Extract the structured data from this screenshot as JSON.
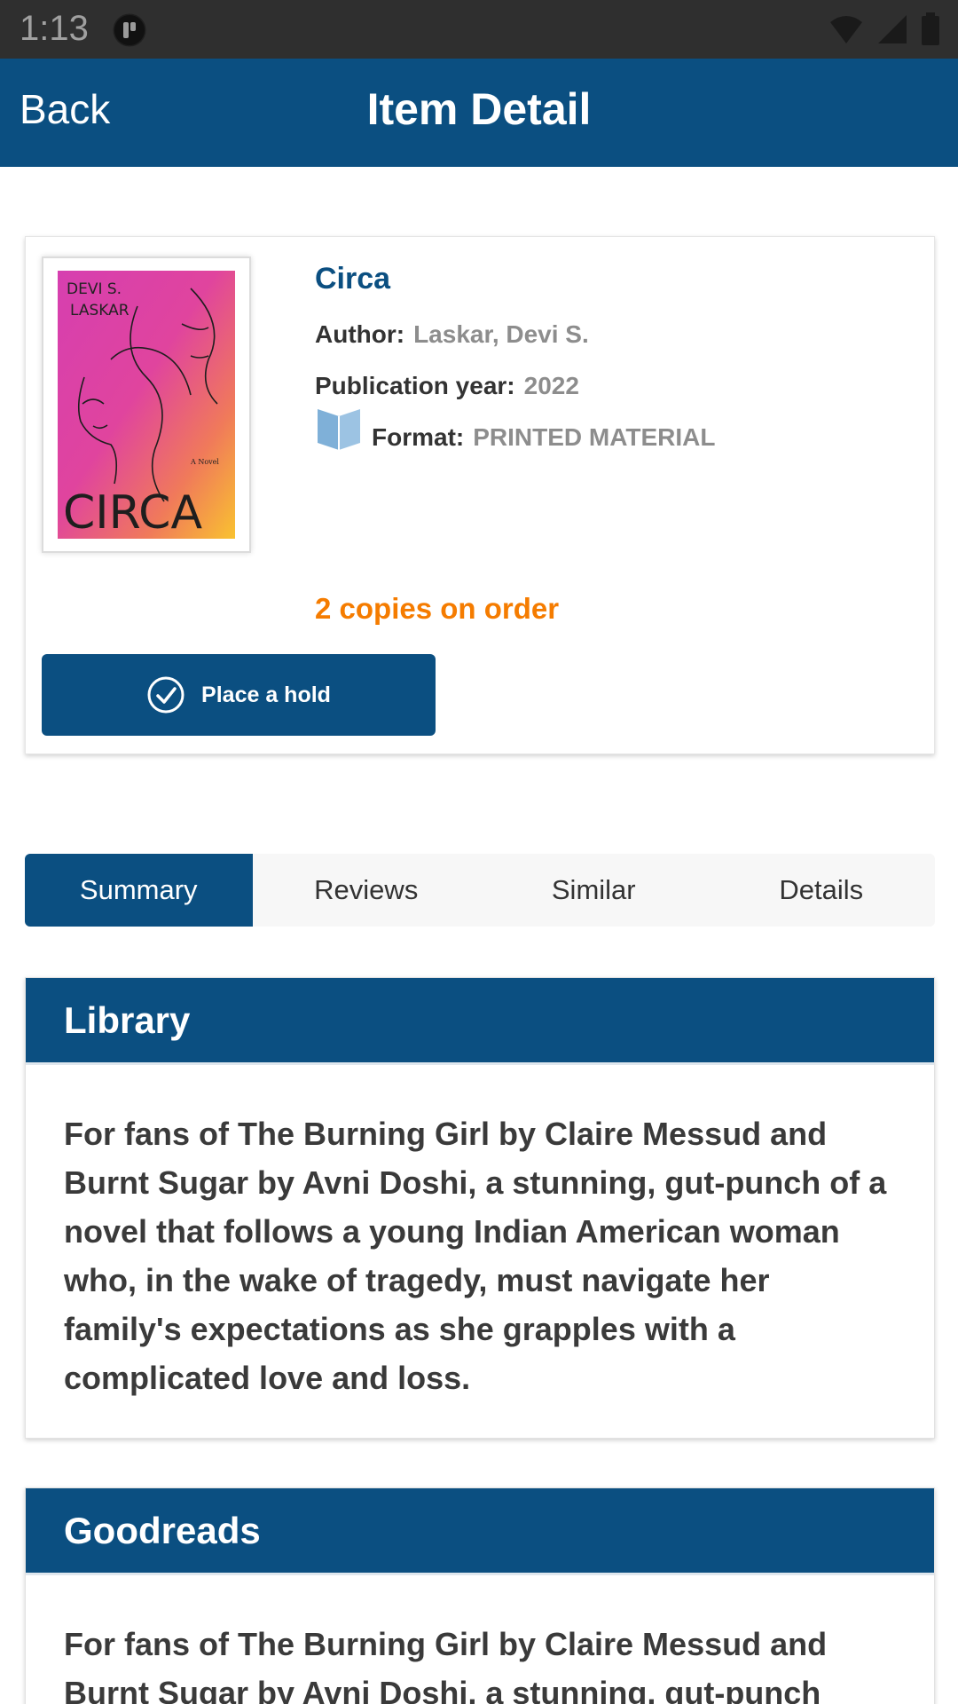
{
  "status_bar": {
    "time": "1:13"
  },
  "app_bar": {
    "back_label": "Back",
    "title": "Item Detail"
  },
  "item": {
    "title": "Circa",
    "author_label": "Author:",
    "author": "Laskar, Devi S.",
    "year_label": "Publication year:",
    "year": "2022",
    "format_label": "Format:",
    "format": "PRINTED MATERIAL",
    "copies_status": "2 copies on order",
    "hold_button_label": "Place a hold",
    "cover_text": {
      "author_line1": "DEVI S.",
      "author_line2": "LASKAR",
      "tag": "A Novel",
      "title": "CIRCA"
    }
  },
  "tabs": [
    {
      "label": "Summary",
      "active": true
    },
    {
      "label": "Reviews",
      "active": false
    },
    {
      "label": "Similar",
      "active": false
    },
    {
      "label": "Details",
      "active": false
    }
  ],
  "panels": {
    "library": {
      "heading": "Library",
      "text": "For fans of The Burning Girl by Claire Messud and Burnt Sugar by Avni Doshi, a stunning, gut-punch of a novel that follows a young Indian American woman who, in the wake of tragedy, must navigate her family's expectations as she grapples with a complicated love and loss."
    },
    "goodreads": {
      "heading": "Goodreads",
      "text": "For fans of The Burning Girl by Claire Messud and Burnt Sugar by Avni Doshi, a stunning, gut-punch"
    }
  },
  "colors": {
    "primary": "#0b4f81",
    "accent_orange": "#f57c00",
    "muted_text": "#8d8d8d"
  },
  "icons": {
    "format": "book-open-icon",
    "hold": "check-circle-icon"
  }
}
